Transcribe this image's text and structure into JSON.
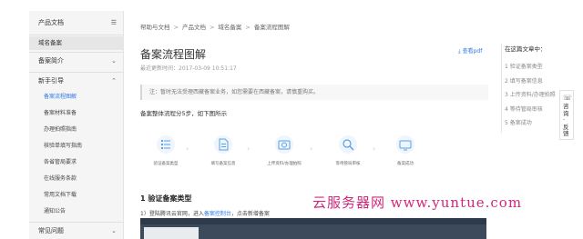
{
  "sidebar": {
    "header": "产品文档",
    "items": [
      {
        "label": "域名备案",
        "type": "plain-active"
      },
      {
        "label": "备案简介",
        "type": "group"
      },
      {
        "label": "新手引导",
        "type": "group-open"
      },
      {
        "label": "备案流程图解",
        "type": "sub-selected"
      },
      {
        "label": "备案材料准备",
        "type": "sub"
      },
      {
        "label": "办理拍照指南",
        "type": "sub"
      },
      {
        "label": "核验单填写指南",
        "type": "sub"
      },
      {
        "label": "各省管局要求",
        "type": "sub"
      },
      {
        "label": "在线服务条款",
        "type": "sub"
      },
      {
        "label": "常用文档下载",
        "type": "sub"
      },
      {
        "label": "通知公告",
        "type": "sub"
      },
      {
        "label": "常见问题",
        "type": "group"
      }
    ]
  },
  "breadcrumb": [
    "帮助与文档",
    "产品文档",
    "域名备案",
    "备案流程图解"
  ],
  "page": {
    "title": "备案流程图解",
    "updated": "最近更新时间：2017-03-09 10:51:17",
    "pdf_link": "查看pdf",
    "note": "注：暂时无法受理西藏备案业务，如您需要在西藏备案，请慎重购买。",
    "flow_title": "备案整体流程分5步，如下图所示"
  },
  "flow_steps": [
    {
      "label": "验证备案类型",
      "icon": "list-icon"
    },
    {
      "label": "填写备案信息",
      "icon": "document-icon"
    },
    {
      "label": "上传资料/办理拍照",
      "icon": "camera-icon"
    },
    {
      "label": "等待管局审核",
      "icon": "magnifier-icon"
    },
    {
      "label": "备案成功",
      "icon": "tv-icon"
    }
  ],
  "section": {
    "title": "1 验证备案类型",
    "line_prefix": "1）登陆腾讯云官网，进入",
    "line_link": "备案控制台",
    "line_suffix": "，点击新增备案"
  },
  "toc": {
    "heading": "在这篇文章中：",
    "items": [
      "1 验证备案类型",
      "2 填写备案信息",
      "3 上传资料/办理拍照",
      "4 等待管局审核",
      "5 备案成功"
    ]
  },
  "float_button": {
    "label": "咨询 · 反馈"
  },
  "watermark": "云服务器网 www.yuntue.com",
  "colors": {
    "accent": "#2c7be5",
    "watermark": "#d0287a"
  }
}
